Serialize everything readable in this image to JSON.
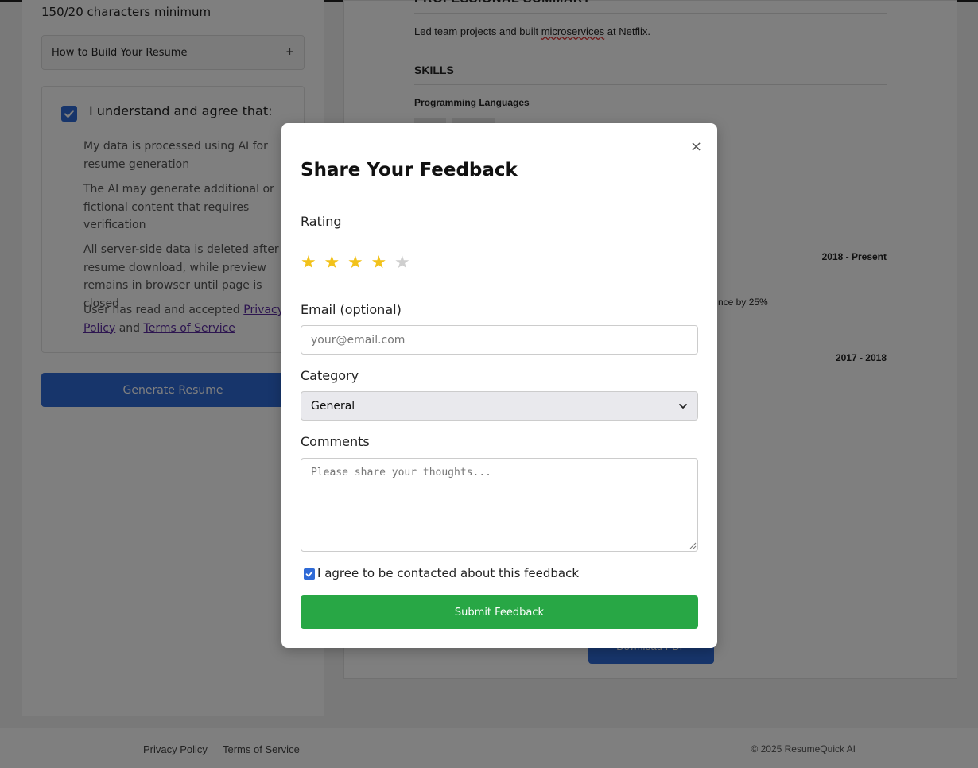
{
  "sidebar": {
    "char_count": "150/20 characters minimum",
    "accordion_label": "How to Build Your Resume",
    "accordion_icon": "+",
    "agree_title": "I understand and agree that:",
    "agree_checked": true,
    "agree_items": [
      "My data is processed using AI for resume generation",
      "The AI may generate additional or fictional content that requires verification",
      "All server-side data is deleted after resume download, while preview remains in browser until page is closed"
    ],
    "agree_last_prefix": "User has read and accepted ",
    "privacy_link": "Privacy Policy",
    "agree_last_and": " and ",
    "terms_link": "Terms of Service",
    "generate_button": "Generate Resume"
  },
  "preview": {
    "summary_heading": "PROFESSIONAL SUMMARY",
    "summary_text_before": "Led team projects and built ",
    "summary_text_underlined": "microservices",
    "summary_text_after": " at Netflix.",
    "skills_heading": "SKILLS",
    "programming_languages": "Programming Languages",
    "job1_dates": "2018 - Present",
    "job1_bullet_fragment": "nce by 25%",
    "job2_dates": "2017 - 2018",
    "download_button": "Download PDF"
  },
  "footer": {
    "privacy": "Privacy Policy",
    "terms": "Terms of Service",
    "copyright": "© 2025 ResumeQuick AI"
  },
  "modal": {
    "close_icon": "×",
    "title": "Share Your Feedback",
    "rating_label": "Rating",
    "rating_value": 4,
    "rating_max": 5,
    "email_label": "Email (optional)",
    "email_placeholder": "your@email.com",
    "email_value": "",
    "category_label": "Category",
    "category_selected": "General",
    "comments_label": "Comments",
    "comments_placeholder": "Please share your thoughts...",
    "comments_value": "",
    "contact_checked": true,
    "contact_label": "I agree to be contacted about this feedback",
    "submit_button": "Submit Feedback"
  },
  "colors": {
    "primary_blue": "#2f6ad6",
    "submit_green": "#28a745",
    "star_gold": "#f2c21b",
    "star_empty": "#cfcfcf",
    "link_purple": "#5a2aa0"
  }
}
